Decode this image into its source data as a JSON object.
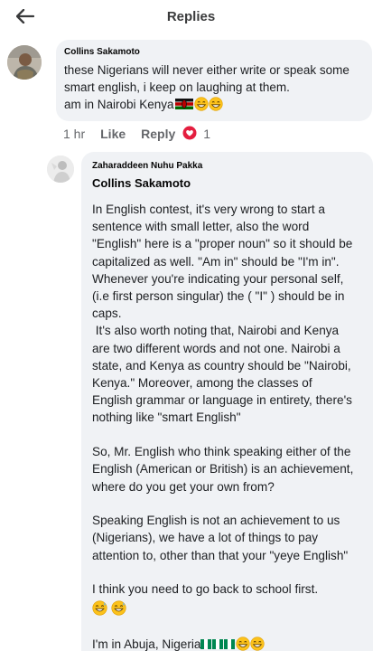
{
  "header": {
    "title": "Replies"
  },
  "reply": {
    "author": "Collins Sakamoto",
    "lines": [
      "these Nigerians will never either write or speak some",
      "smart english, i keep on laughing at them.",
      "am in Nairobi Kenya"
    ],
    "time": "1 hr",
    "like_label": "Like",
    "reply_label": "Reply",
    "reaction_count": "1"
  },
  "response": {
    "author": "Zaharaddeen Nuhu Pakka",
    "mention": "Collins Sakamoto",
    "p1": [
      "In English contest, it's very wrong to start a",
      "sentence with small letter, also the word",
      "\"English\" here is a \"proper noun\" so it should be",
      "capitalized as well. \"Am in\" should be \"I'm in\".",
      "Whenever you're indicating your personal self,",
      "(i.e first person singular) the ( \"I\" ) should be in",
      "caps.",
      " It's also worth noting that, Nairobi and Kenya",
      "are two different words and not one. Nairobi a",
      "state, and Kenya as country should be \"Nairobi,",
      "Kenya.\" Moreover, among the classes of",
      "English grammar or language in entirety, there's",
      "nothing like \"smart English\""
    ],
    "p2": [
      "So, Mr. English who think speaking either of the",
      "English (American or British) is an achievement,",
      "where do you get your own from?"
    ],
    "p3": [
      "Speaking English is not an achievement to us",
      "(Nigerians), we have a lot of things to pay",
      "attention to, other than that your \"yeye English\""
    ],
    "p4": "I think you need to go back to school first.",
    "p5": "I'm in Abuja, Nigeria"
  },
  "colors": {
    "bubble": "#f0f2f5",
    "text": "#1c1e21",
    "meta": "#65676b",
    "reaction": "#e41e3f",
    "emoji_face": "#fcc21b"
  }
}
